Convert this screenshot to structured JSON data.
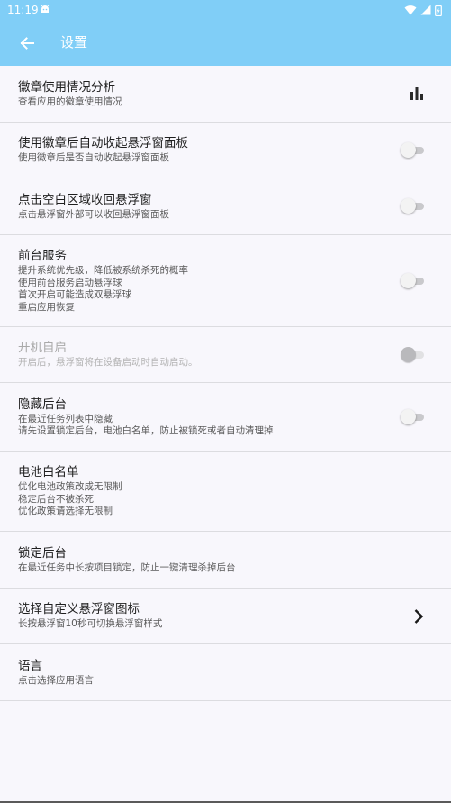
{
  "status_bar": {
    "time": "11:19"
  },
  "app_bar": {
    "title": "设置"
  },
  "settings": [
    {
      "title": "徽章使用情况分析",
      "lines": [
        "查看应用的徽章使用情况"
      ],
      "control": "chart-icon"
    },
    {
      "title": "使用徽章后自动收起悬浮窗面板",
      "lines": [
        "使用徽章后是否自动收起悬浮窗面板"
      ],
      "control": "toggle",
      "on": false
    },
    {
      "title": "点击空白区域收回悬浮窗",
      "lines": [
        "点击悬浮窗外部可以收回悬浮窗面板"
      ],
      "control": "toggle",
      "on": false
    },
    {
      "title": "前台服务",
      "lines": [
        "提升系统优先级，降低被系统杀死的概率",
        "使用前台服务启动悬浮球",
        "首次开启可能造成双悬浮球",
        "重启应用恢复"
      ],
      "control": "toggle",
      "on": false
    },
    {
      "title": "开机自启",
      "lines": [
        "开启后，悬浮窗将在设备启动时自动启动。"
      ],
      "control": "toggle",
      "on": false,
      "disabled": true
    },
    {
      "title": "隐藏后台",
      "lines": [
        "在最近任务列表中隐藏",
        "请先设置锁定后台，电池白名单，防止被锁死或者自动清理掉"
      ],
      "control": "toggle",
      "on": false
    },
    {
      "title": "电池白名单",
      "lines": [
        "优化电池政策改成无限制",
        "稳定后台不被杀死",
        "优化政策请选择无限制"
      ],
      "control": "none"
    },
    {
      "title": "锁定后台",
      "lines": [
        "在最近任务中长按项目锁定，防止一键清理杀掉后台"
      ],
      "control": "none"
    },
    {
      "title": "选择自定义悬浮窗图标",
      "lines": [
        "长按悬浮窗10秒可切换悬浮窗样式"
      ],
      "control": "chevron-right-icon"
    },
    {
      "title": "语言",
      "lines": [
        "点击选择应用语言"
      ],
      "control": "none"
    }
  ],
  "colors": {
    "app_bar": "#80cef7",
    "background": "#f8f7fc",
    "divider": "#dcdce0",
    "title_text": "#1f1f1f",
    "subtitle_text": "#5a5a5a"
  }
}
